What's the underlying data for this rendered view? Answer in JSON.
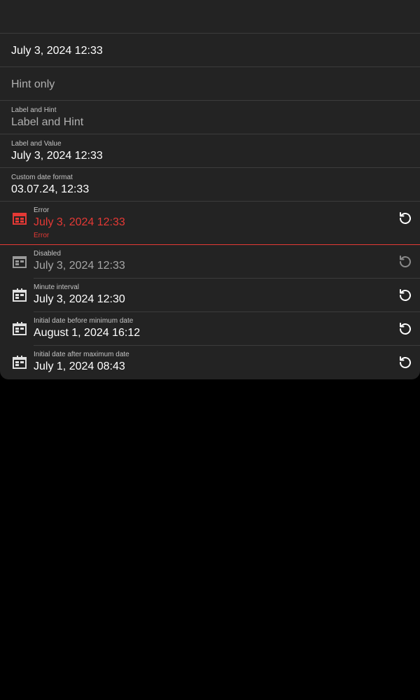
{
  "colors": {
    "background": "#000000",
    "surface": "#232323",
    "divider": "#3c3c3c",
    "text": "#ffffff",
    "hint": "#b0b0b0",
    "label": "#c4c4c4",
    "error": "#e53935",
    "icon": "#e0e0e0"
  },
  "fields": [
    {
      "label": "",
      "value": ""
    },
    {
      "label": "",
      "value": "July 3, 2024 12:33"
    },
    {
      "label": "",
      "value": "Hint only"
    },
    {
      "label": "Label and Hint",
      "value": "Label and Hint"
    },
    {
      "label": "Label and Value",
      "value": "July 3, 2024 12:33"
    },
    {
      "label": "Custom date format",
      "value": "03.07.24, 12:33"
    },
    {
      "label": "Error",
      "value": "July 3, 2024 12:33",
      "helper": "Error",
      "icon": "calendar-icon",
      "action_icon": "reset-icon"
    },
    {
      "label": "Disabled",
      "value": "July 3, 2024 12:33",
      "icon": "calendar-icon",
      "action_icon": "reset-icon"
    },
    {
      "label": "Minute interval",
      "value": "July 3, 2024 12:30",
      "icon": "calendar-icon",
      "action_icon": "reset-icon"
    },
    {
      "label": "Initial date before minimum date",
      "value": "August 1, 2024 16:12",
      "icon": "calendar-icon",
      "action_icon": "reset-icon"
    },
    {
      "label": "Initial date after maximum date",
      "value": "July 1, 2024 08:43",
      "icon": "calendar-icon",
      "action_icon": "reset-icon"
    }
  ]
}
